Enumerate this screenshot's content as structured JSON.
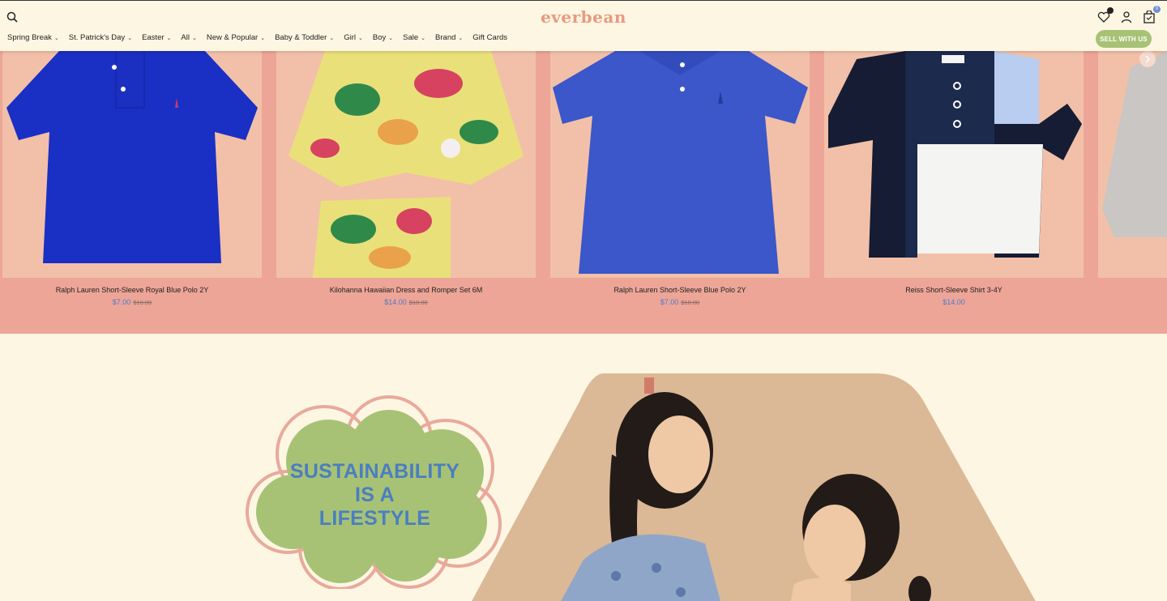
{
  "brand": {
    "logo": "everbean"
  },
  "header": {
    "sell_label": "SELL WITH US",
    "cart_count": "0",
    "nav": [
      {
        "label": "Spring Break",
        "has_dropdown": true
      },
      {
        "label": "St. Patrick's Day",
        "has_dropdown": true
      },
      {
        "label": "Easter",
        "has_dropdown": true
      },
      {
        "label": "All",
        "has_dropdown": true
      },
      {
        "label": "New & Popular",
        "has_dropdown": true
      },
      {
        "label": "Baby & Toddler",
        "has_dropdown": true
      },
      {
        "label": "Girl",
        "has_dropdown": true
      },
      {
        "label": "Boy",
        "has_dropdown": true
      },
      {
        "label": "Sale",
        "has_dropdown": true
      },
      {
        "label": "Brand",
        "has_dropdown": true
      },
      {
        "label": "Gift Cards",
        "has_dropdown": false
      }
    ]
  },
  "products": [
    {
      "title": "Ralph Lauren Short-Sleeve Royal Blue Polo 2Y",
      "price": "$7.00",
      "compare_price": "$10.00",
      "image": "royal-blue-polo"
    },
    {
      "title": "Kilohanna Hawaiian Dress and Romper Set 6M",
      "price": "$14.00",
      "compare_price": "$18.00",
      "image": "hawaiian-dress-romper"
    },
    {
      "title": "Ralph Lauren Short-Sleeve Blue Polo 2Y",
      "price": "$7.00",
      "compare_price": "$10.00",
      "image": "blue-polo"
    },
    {
      "title": "Reiss Short-Sleeve Shirt 3-4Y",
      "price": "$14.00",
      "compare_price": "",
      "image": "colorblock-shirt"
    }
  ],
  "promo": {
    "line1": "SUSTAINABILITY",
    "line2": "IS A",
    "line3": "LIFESTYLE"
  },
  "colors": {
    "accent": "#a7c275",
    "price": "#4f79c8",
    "logo": "#e89a80",
    "carousel_bg": "#eda597",
    "page_bg": "#fdf6e3"
  },
  "icons": [
    "search-icon",
    "heart-icon",
    "account-icon",
    "cart-icon",
    "chevron-down-icon",
    "chevron-right-icon"
  ]
}
